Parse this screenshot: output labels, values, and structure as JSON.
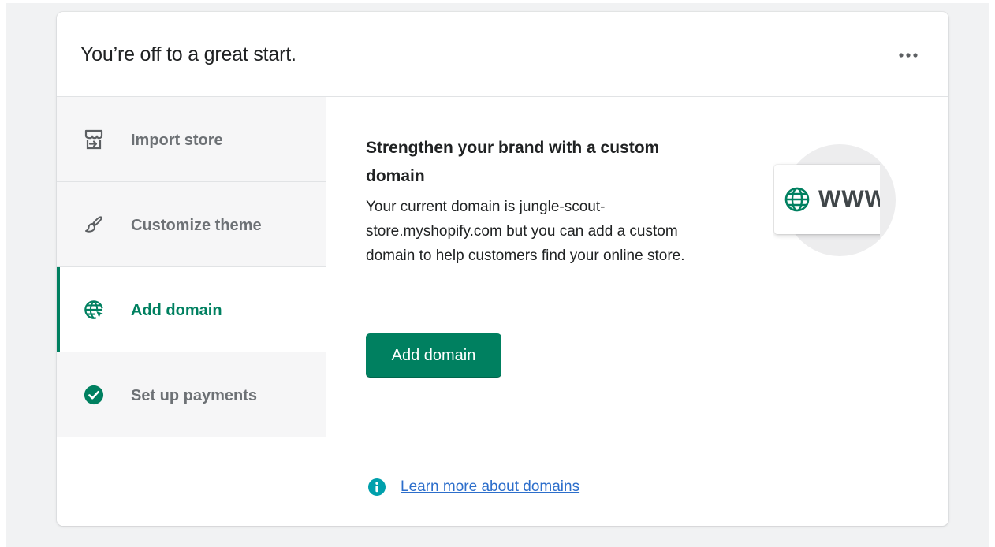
{
  "header": {
    "title": "You’re off to a great start.",
    "more_icon": "ellipsis-horizontal-icon"
  },
  "steps": [
    {
      "label": "Import store",
      "icon": "import-store-icon",
      "active": false
    },
    {
      "label": "Customize theme",
      "icon": "paintbrush-icon",
      "active": false
    },
    {
      "label": "Add domain",
      "icon": "globe-cursor-icon",
      "active": true
    },
    {
      "label": "Set up payments",
      "icon": "checkmark-circle-icon",
      "active": false,
      "completed": true
    }
  ],
  "content": {
    "title": "Strengthen your brand with a custom domain",
    "body": "Your current domain is jungle-scout-store.myshopify.com but you can add a custom domain to help customers find your online store.",
    "button_label": "Add domain",
    "learn_more": "Learn more about domains",
    "illustration_text": "WWW"
  },
  "colors": {
    "accent": "#008060",
    "link": "#2c6ecb",
    "info": "#00a0ac",
    "text": "#202223",
    "muted": "#6d7175"
  }
}
